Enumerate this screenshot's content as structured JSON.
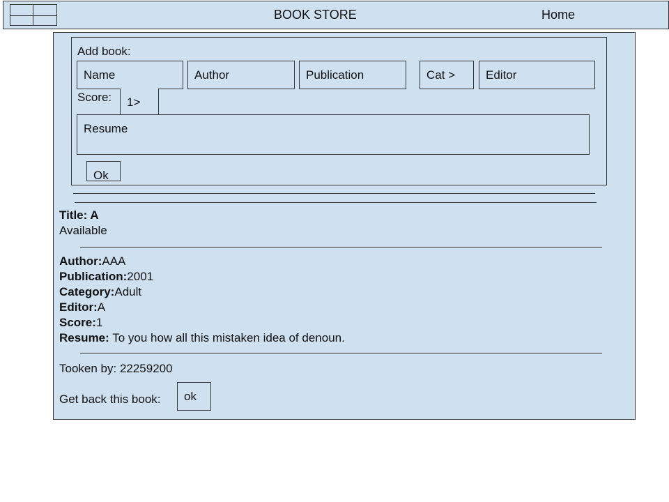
{
  "header": {
    "title": "BOOK STORE",
    "home_label": "Home"
  },
  "add_book": {
    "heading": "Add book:",
    "name_placeholder": "Name",
    "author_placeholder": "Author",
    "publication_placeholder": "Publication",
    "category_select": "Cat >",
    "editor_placeholder": "Editor",
    "score_label": "Score:",
    "score_select": "1>",
    "resume_placeholder": "Resume",
    "ok_label": "Ok"
  },
  "book": {
    "title_label": "Title: A",
    "availability": "Available",
    "author_label": "Author:",
    "author_value": "AAA",
    "publication_label": "Publication:",
    "publication_value": "2001",
    "category_label": "Category:",
    "category_value": "Adult",
    "editor_label": "Editor:",
    "editor_value": "A",
    "score_label": "Score:",
    "score_value": "1",
    "resume_label": "Resume:",
    "resume_value": " To you how all this mistaken idea of denoun.",
    "taken_by": "Tooken by: 22259200",
    "get_back_label": "Get back this book:",
    "get_back_button": "ok"
  }
}
